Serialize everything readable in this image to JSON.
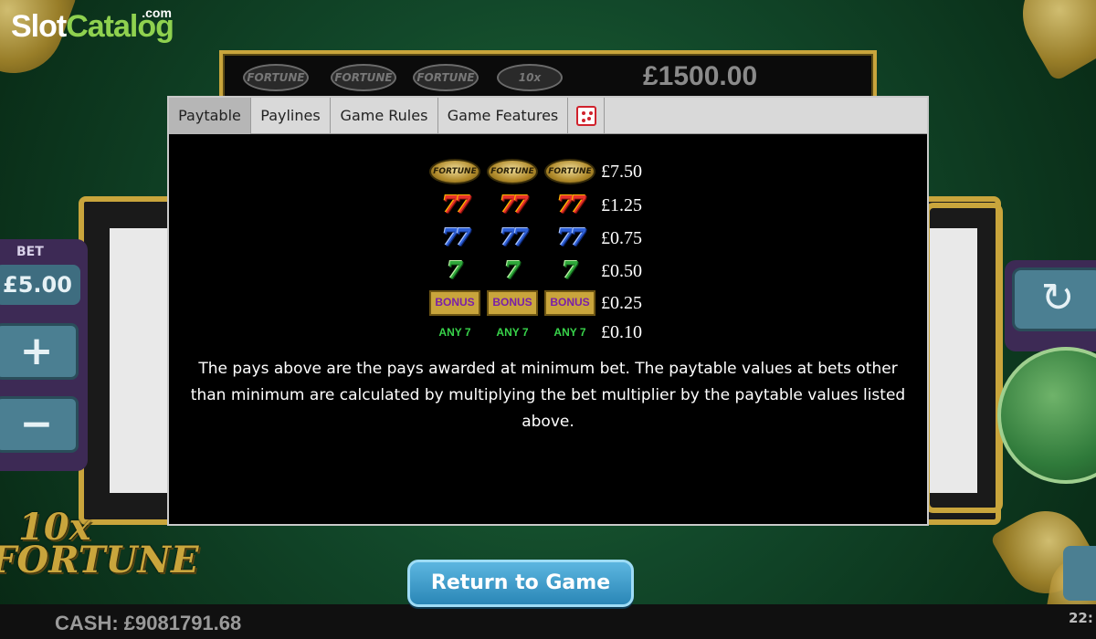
{
  "brand": {
    "logo_slot": "Slot",
    "logo_catalog": "Catalog",
    "logo_com": ".com"
  },
  "game": {
    "top_symbols": [
      "FORTUNE",
      "FORTUNE",
      "FORTUNE",
      "10x"
    ],
    "jackpot": "£1500.00",
    "bet_label": "BET",
    "bet_value": "£5.00",
    "plus": "+",
    "minus": "−",
    "refresh_icon": "↻",
    "logo_line1": "10x",
    "logo_line2": "FORTUNE",
    "cash": "CASH: £9081791.68",
    "time": "22:"
  },
  "modal": {
    "tabs": [
      {
        "label": "Paytable",
        "active": true
      },
      {
        "label": "Paylines",
        "active": false
      },
      {
        "label": "Game Rules",
        "active": false
      },
      {
        "label": "Game Features",
        "active": false
      }
    ],
    "tab_icon": "dice-logo-icon",
    "paytable": [
      {
        "symbol": "FORTUNE",
        "type": "fortune",
        "prize": "£7.50"
      },
      {
        "symbol": "7",
        "type": "red-seven",
        "prize": "£1.25"
      },
      {
        "symbol": "7",
        "type": "blue-seven",
        "prize": "£0.75"
      },
      {
        "symbol": "7",
        "type": "green-seven",
        "prize": "£0.50"
      },
      {
        "symbol": "BONUS",
        "type": "bonus",
        "prize": "£0.25"
      },
      {
        "symbol": "ANY 7",
        "type": "any-seven",
        "prize": "£0.10"
      }
    ],
    "note": "The pays above are the pays awarded at minimum bet. The paytable values at bets other than minimum are calculated by multiplying the bet multiplier by the paytable values listed above."
  },
  "return_button": "Return to Game",
  "colors": {
    "accent_gold": "#c9a53c",
    "return_button": "#2a86b6",
    "modal_bg": "#000000",
    "tab_bar": "#d9d9d9"
  }
}
